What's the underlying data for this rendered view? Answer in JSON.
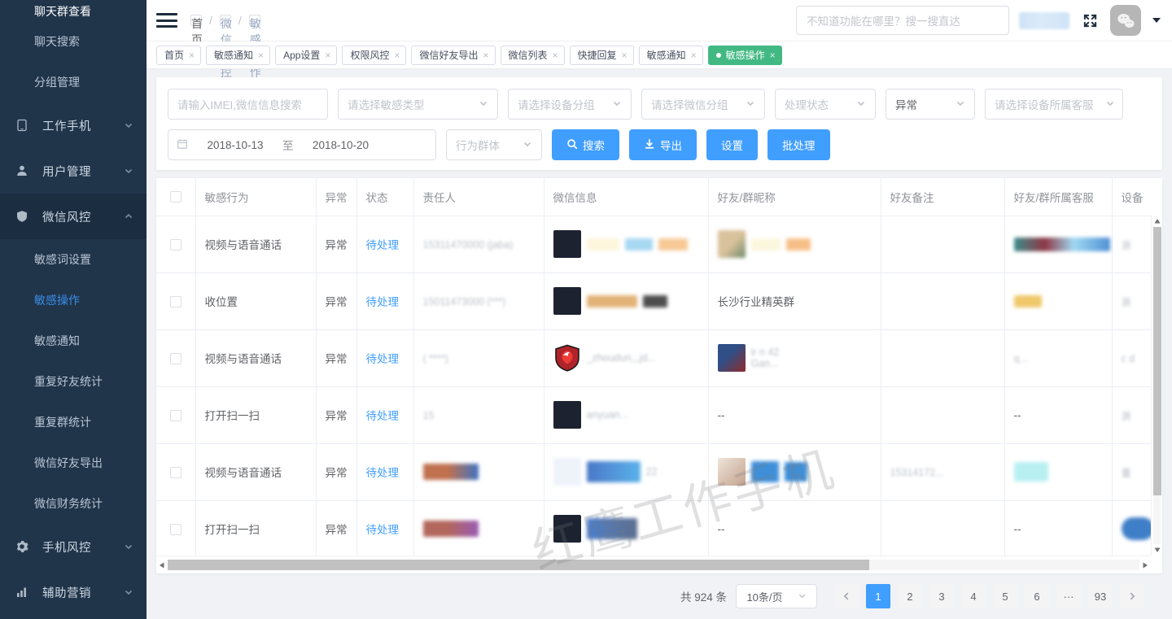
{
  "sidebar": {
    "top_partial_item": "聊天群查看",
    "items": [
      {
        "label": "聊天搜索",
        "type": "sub"
      },
      {
        "label": "分组管理",
        "type": "sub"
      },
      {
        "label": "工作手机",
        "type": "group",
        "icon": "monitor-icon",
        "expanded": false
      },
      {
        "label": "用户管理",
        "type": "group",
        "icon": "user-icon",
        "expanded": false
      },
      {
        "label": "微信风控",
        "type": "group",
        "icon": "shield-icon",
        "expanded": true
      },
      {
        "label": "敏感词设置",
        "type": "sub"
      },
      {
        "label": "敏感操作",
        "type": "sub",
        "active": true
      },
      {
        "label": "敏感通知",
        "type": "sub"
      },
      {
        "label": "重复好友统计",
        "type": "sub"
      },
      {
        "label": "重复群统计",
        "type": "sub"
      },
      {
        "label": "微信好友导出",
        "type": "sub"
      },
      {
        "label": "微信财务统计",
        "type": "sub"
      },
      {
        "label": "手机风控",
        "type": "group",
        "icon": "gear-icon",
        "expanded": false
      },
      {
        "label": "辅助营销",
        "type": "group",
        "icon": "chart-icon",
        "expanded": false
      }
    ]
  },
  "header": {
    "breadcrumb": [
      "首页",
      "微信风控",
      "敏感操作"
    ],
    "search_placeholder": "不知道功能在哪里？搜一搜直达"
  },
  "tabs": [
    {
      "label": "首页",
      "active": false
    },
    {
      "label": "敏感通知",
      "active": false
    },
    {
      "label": "App设置",
      "active": false
    },
    {
      "label": "权限风控",
      "active": false
    },
    {
      "label": "微信好友导出",
      "active": false
    },
    {
      "label": "微信列表",
      "active": false
    },
    {
      "label": "快捷回复",
      "active": false
    },
    {
      "label": "敏感通知",
      "active": false
    },
    {
      "label": "敏感操作",
      "active": true
    }
  ],
  "filters": {
    "imei_placeholder": "请输入IMEI,微信信息搜索",
    "imei_value": "",
    "sensitive_type": "请选择敏感类型",
    "device_group": "请选择设备分组",
    "wechat_group": "请选择微信分组",
    "handle_status": "处理状态",
    "abnormal": "异常",
    "device_cs": "请选择设备所属客服",
    "date_start": "2018-10-13",
    "date_to": "至",
    "date_end": "2018-10-20",
    "behavior_group": "行为群体",
    "btn_search": "搜索",
    "btn_export": "导出",
    "btn_settings": "设置",
    "btn_batch": "批处理"
  },
  "table": {
    "columns": [
      "",
      "敏感行为",
      "异常",
      "状态",
      "责任人",
      "微信信息",
      "好友/群昵称",
      "好友备注",
      "好友/群所属客服",
      "设备"
    ],
    "rows": [
      {
        "behavior": "视频与语音通话",
        "abnormal": "异常",
        "status": "待处理",
        "owner": "",
        "wechat": "",
        "nick": "",
        "note": "",
        "cs": "",
        "device": ""
      },
      {
        "behavior": "收位置",
        "abnormal": "异常",
        "status": "待处理",
        "owner": "",
        "wechat": "",
        "nick": "长沙行业精英群",
        "note": "",
        "cs": "",
        "device": ""
      },
      {
        "behavior": "视频与语音通话",
        "abnormal": "异常",
        "status": "待处理",
        "owner": "",
        "wechat": "",
        "nick": "",
        "note": "",
        "cs": "",
        "device": ""
      },
      {
        "behavior": "打开扫一扫",
        "abnormal": "异常",
        "status": "待处理",
        "owner": "",
        "wechat": "",
        "nick": "--",
        "note": "",
        "cs": "--",
        "device": ""
      },
      {
        "behavior": "视频与语音通话",
        "abnormal": "异常",
        "status": "待处理",
        "owner": "",
        "wechat": "",
        "nick": "",
        "note": "",
        "cs": "",
        "device": ""
      },
      {
        "behavior": "打开扫一扫",
        "abnormal": "异常",
        "status": "待处理",
        "owner": "",
        "wechat": "",
        "nick": "--",
        "note": "",
        "cs": "--",
        "device": ""
      }
    ]
  },
  "watermark": "红鹰工作手机",
  "pagination": {
    "total_text": "共 924 条",
    "page_size": "10条/页",
    "pages": [
      "1",
      "2",
      "3",
      "4",
      "5",
      "6",
      "···",
      "93"
    ],
    "current": "1"
  },
  "colors": {
    "primary": "#409eff",
    "active_tab": "#42b983",
    "sidebar": "#20344a"
  }
}
